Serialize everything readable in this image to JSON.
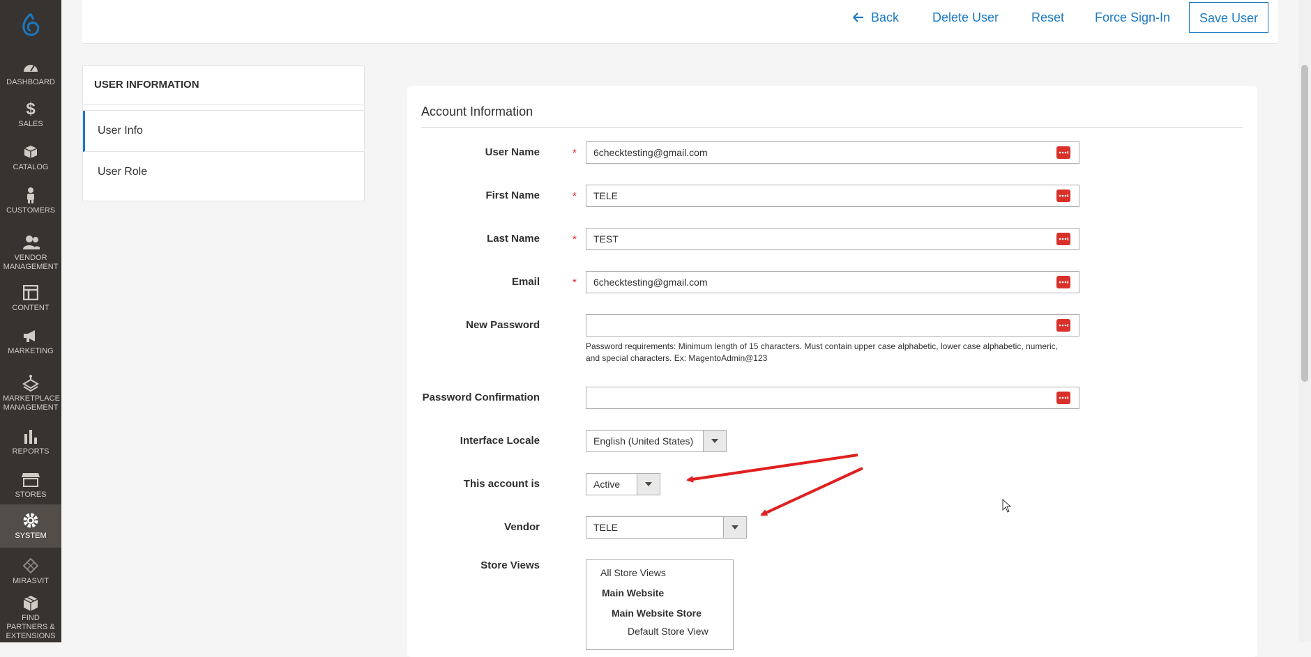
{
  "nav": {
    "items": [
      {
        "label": "DASHBOARD",
        "icon": "dashboard-icon"
      },
      {
        "label": "SALES",
        "icon": "dollar-icon"
      },
      {
        "label": "CATALOG",
        "icon": "box-icon"
      },
      {
        "label": "CUSTOMERS",
        "icon": "person-icon"
      },
      {
        "label": "VENDOR MANAGEMENT",
        "icon": "people-icon"
      },
      {
        "label": "CONTENT",
        "icon": "layout-icon"
      },
      {
        "label": "MARKETING",
        "icon": "megaphone-icon"
      },
      {
        "label": "MARKETPLACE MANAGEMENT",
        "icon": "bag-icon"
      },
      {
        "label": "REPORTS",
        "icon": "bar-chart-icon"
      },
      {
        "label": "STORES",
        "icon": "store-icon"
      },
      {
        "label": "SYSTEM",
        "icon": "gear-icon"
      },
      {
        "label": "MIRASVIT",
        "icon": "diamond-icon"
      },
      {
        "label": "FIND PARTNERS & EXTENSIONS",
        "icon": "cubes-icon"
      }
    ]
  },
  "header": {
    "back": "Back",
    "delete": "Delete User",
    "reset": "Reset",
    "force": "Force Sign-In",
    "save": "Save User"
  },
  "tabs": {
    "title": "USER INFORMATION",
    "items": [
      "User Info",
      "User Role"
    ]
  },
  "form": {
    "section_title": "Account Information",
    "username": {
      "label": "User Name",
      "value": "6checktesting@gmail.com"
    },
    "firstname": {
      "label": "First Name",
      "value": "TELE"
    },
    "lastname": {
      "label": "Last Name",
      "value": "TEST"
    },
    "email": {
      "label": "Email",
      "value": "6checktesting@gmail.com"
    },
    "new_password": {
      "label": "New Password",
      "value": ""
    },
    "password_note": "Password requirements: Minimum length of 15 characters. Must contain upper case alphabetic, lower case alphabetic, numeric, and special characters. Ex: MagentoAdmin@123",
    "password_confirm": {
      "label": "Password Confirmation",
      "value": ""
    },
    "locale": {
      "label": "Interface Locale",
      "value": "English (United States)"
    },
    "account_status": {
      "label": "This account is",
      "value": "Active"
    },
    "vendor": {
      "label": "Vendor",
      "value": "TELE"
    },
    "store_views": {
      "label": "Store Views",
      "options": [
        "All Store Views",
        "Main Website",
        "Main Website Store",
        "Default Store View"
      ]
    },
    "required_mark": "*"
  },
  "colors": {
    "accent": "#1979c3",
    "annotation": "#e02020",
    "required": "#e22626",
    "nav_bg": "#373330"
  }
}
